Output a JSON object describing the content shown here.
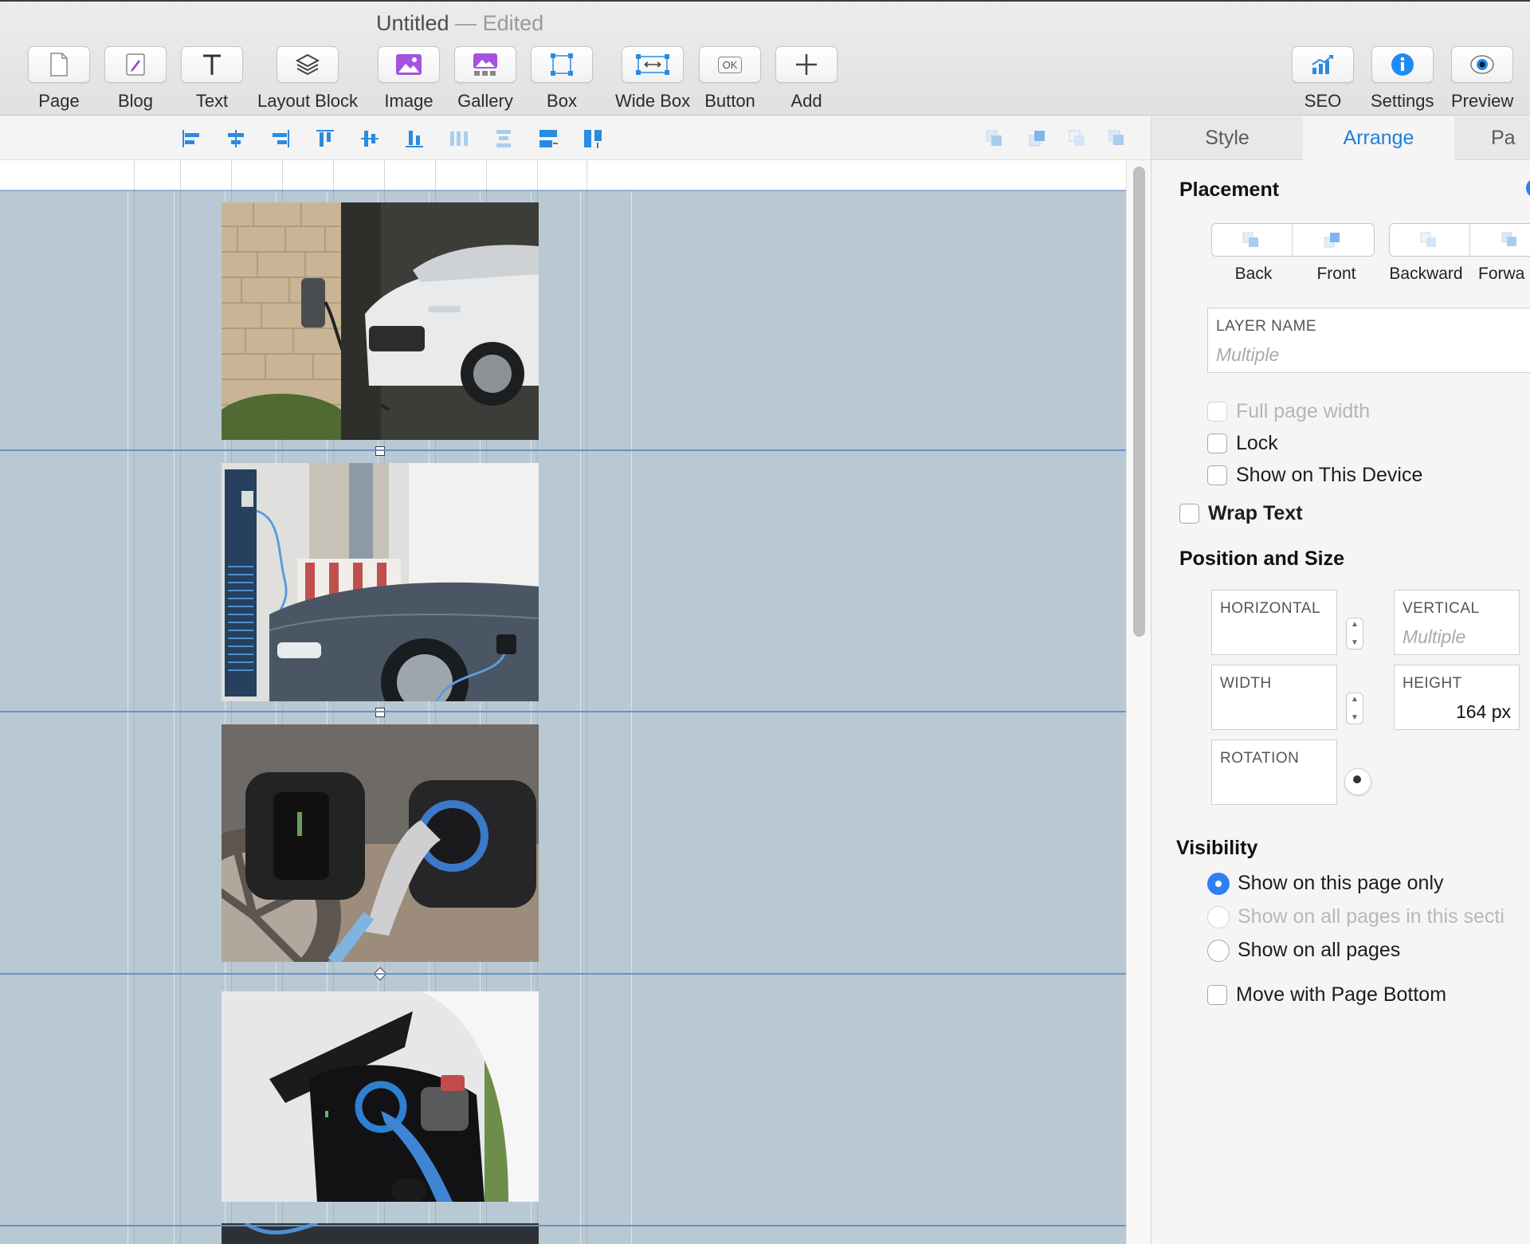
{
  "window": {
    "title": "Untitled",
    "separator": "—",
    "status": "Edited"
  },
  "toolbar": {
    "tools": [
      {
        "label": "Page",
        "icon": "page-icon"
      },
      {
        "label": "Blog",
        "icon": "blog-icon"
      },
      {
        "label": "Text",
        "icon": "text-icon"
      },
      {
        "label": "Layout Block",
        "icon": "layers-icon"
      },
      {
        "label": "Image",
        "icon": "image-icon"
      },
      {
        "label": "Gallery",
        "icon": "gallery-icon"
      },
      {
        "label": "Box",
        "icon": "box-icon"
      },
      {
        "label": "Wide Box",
        "icon": "wide-box-icon"
      },
      {
        "label": "Button",
        "icon": "button-icon",
        "glyph": "OK"
      },
      {
        "label": "Add",
        "icon": "plus-icon"
      }
    ],
    "right_tools": [
      {
        "label": "SEO",
        "icon": "seo-chart-icon"
      },
      {
        "label": "Settings",
        "icon": "info-icon"
      },
      {
        "label": "Preview",
        "icon": "eye-icon"
      }
    ]
  },
  "inspector": {
    "tabs": [
      {
        "label": "Style",
        "active": false
      },
      {
        "label": "Arrange",
        "active": true
      },
      {
        "label": "Pa",
        "active": false
      }
    ],
    "placement": {
      "heading": "Placement",
      "buttons": [
        "Back",
        "Front",
        "Backward",
        "Forwa"
      ]
    },
    "layer_name": {
      "caption": "LAYER NAME",
      "placeholder": "Multiple"
    },
    "options": [
      {
        "label": "Full page width",
        "checked": false,
        "disabled": true
      },
      {
        "label": "Lock",
        "checked": false,
        "disabled": false
      },
      {
        "label": "Show on This Device",
        "checked": false,
        "disabled": false
      }
    ],
    "wrap_text": {
      "label": "Wrap Text",
      "checked": false
    },
    "position_size": {
      "heading": "Position and Size",
      "horizontal": {
        "caption": "HORIZONTAL",
        "value": ""
      },
      "vertical": {
        "caption": "VERTICAL",
        "value": "Multiple"
      },
      "width": {
        "caption": "WIDTH",
        "value": ""
      },
      "height": {
        "caption": "HEIGHT",
        "value": "164 px"
      },
      "rotation": {
        "caption": "ROTATION",
        "value": ""
      }
    },
    "visibility": {
      "heading": "Visibility",
      "options": [
        {
          "label": "Show on this page only",
          "selected": true,
          "disabled": false
        },
        {
          "label": "Show on all pages in this secti",
          "selected": false,
          "disabled": true
        },
        {
          "label": "Show on all pages",
          "selected": false,
          "disabled": false
        }
      ],
      "move_with_bottom": {
        "label": "Move with Page Bottom",
        "checked": false
      }
    }
  },
  "colors": {
    "accent": "#1f7fd9",
    "canvas_section": "#b8c9d3",
    "guide": "#6b8fc7"
  }
}
